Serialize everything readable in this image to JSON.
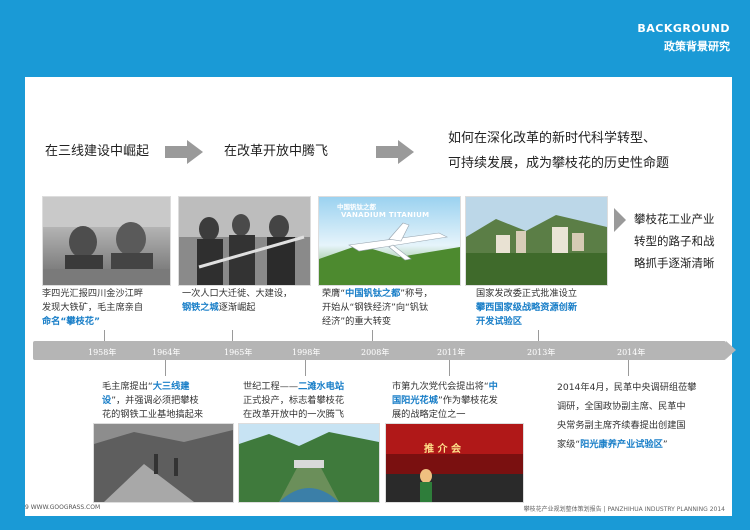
{
  "header": {
    "title_en": "BACKGROUND",
    "title_cn": "政策背景研究"
  },
  "phases": [
    {
      "text": "在三线建设中崛起"
    },
    {
      "text": "在改革开放中腾飞"
    },
    {
      "text_line1": "如何在深化改革的新时代科学转型、",
      "text_line2": "可持续发展，成为攀枝花的历史性命题"
    }
  ],
  "top_captions": [
    {
      "l1": "李四光汇报四川金沙江畔",
      "l2": "发现大铁矿，毛主席亲自",
      "l3_a": "命名",
      "l3_b": "“攀枝花”"
    },
    {
      "l1": "一次人口大迁徙、大建设，",
      "l2_a": "钢铁之城",
      "l2_b": "逐渐崛起"
    },
    {
      "l1_a": "荣膺“",
      "l1_b": "中国钒钛之都",
      "l1_c": "”称号，",
      "l2": "开始从“钢铁经济”向“钒钛",
      "l3": "经济”的重大转变"
    },
    {
      "l1": "国家发改委正式批准设立",
      "l2": "攀西国家级战略资源创新",
      "l3": "开发试验区"
    }
  ],
  "right_text": {
    "l1": "攀枝花工业产业",
    "l2": "转型的路子和战",
    "l3": "略抓手逐渐清晰"
  },
  "photo_labels": {
    "banner_cn": "中国钒钛之都",
    "banner_en": "VANADIUM TITANIUM",
    "hall_text": "推  介  会"
  },
  "timeline": {
    "years": [
      "1958年",
      "1964年",
      "1965年",
      "1998年",
      "2008年",
      "2011年",
      "2013年",
      "2014年"
    ]
  },
  "bottom_captions": [
    {
      "l1_a": "毛主席提出“",
      "l1_b": "大三线建",
      "l2_a": "设",
      "l2_b": "”，并强调必须把攀枝",
      "l3": "花的钢铁工业基地搞起来"
    },
    {
      "l1_a": "世纪工程——",
      "l1_b": "二滩水电站",
      "l2": "正式投产，标志着攀枝花",
      "l3": "在改革开放中的一次腾飞"
    },
    {
      "l1_a": "市第九次党代会提出将“",
      "l1_b": "中",
      "l2_a": "国阳光花城",
      "l2_b": "”作为攀枝花发",
      "l3": "展的战略定位之一"
    },
    {
      "l1": "2014年4月，民革中央调研组莅攀",
      "l2": "调研，全国政协副主席、民革中",
      "l3": "央常务副主席齐续春提出创建国",
      "l4_a": "家级“",
      "l4_b": "阳光康养产业试验区",
      "l4_c": "”"
    }
  ],
  "footer": {
    "left": "9  WWW.GOOGRASS.COM",
    "right": "攀枝花产业规划整体策划报告 | PANZHIHUA INDUSTRY PLANNING 2014"
  }
}
